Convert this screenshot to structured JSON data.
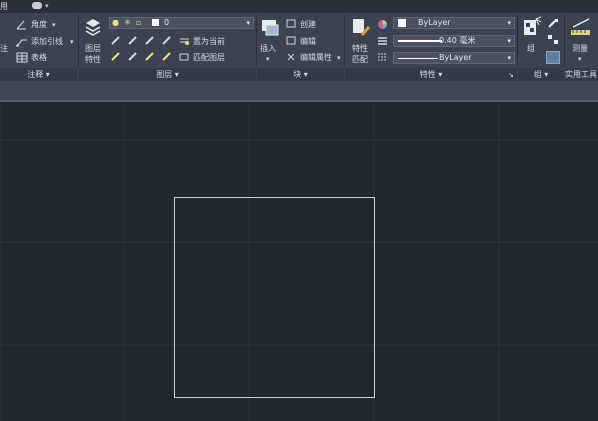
{
  "tabbar": {
    "prev_tab": "用",
    "cloud_caret": "▾"
  },
  "annotation": {
    "truncated_label": "注",
    "angle": "角度",
    "leader": "添加引线",
    "leader_arrow": "▾",
    "table": "表格",
    "footer": "注释 ▾"
  },
  "layers": {
    "props_line1": "图层",
    "props_line2": "特性",
    "layer_value": "0",
    "set_current": "置为当前",
    "match_layer": "匹配图层",
    "footer": "图层 ▾"
  },
  "block": {
    "insert": "插入",
    "create": "创建",
    "edit": "编辑",
    "edit_attributes": "编辑属性",
    "footer": "块 ▾"
  },
  "properties": {
    "match_line1": "特性",
    "match_line2": "匹配",
    "color": "ByLayer",
    "lineweight": "0.40 毫米",
    "linetype": "ByLayer",
    "footer": "特性 ▾"
  },
  "groups": {
    "group": "组",
    "footer": "组 ▾"
  },
  "utilities": {
    "measure": "测量",
    "footer": "实用工具"
  },
  "colors": {
    "ribbon_bg": "#3b4350",
    "canvas_bg": "#212830",
    "grid_line": "#2b333d",
    "square_stroke": "#c9ced4"
  }
}
